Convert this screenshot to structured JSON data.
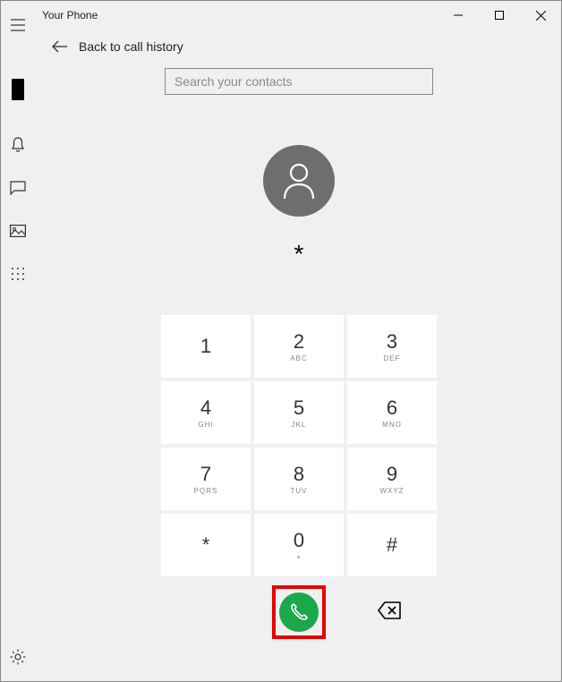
{
  "app": {
    "title": "Your Phone"
  },
  "back": {
    "label": "Back to call history"
  },
  "search": {
    "placeholder": "Search your contacts",
    "value": ""
  },
  "dialed": "*",
  "keypad": [
    {
      "digit": "1",
      "letters": ""
    },
    {
      "digit": "2",
      "letters": "ABC"
    },
    {
      "digit": "3",
      "letters": "DEF"
    },
    {
      "digit": "4",
      "letters": "GHI"
    },
    {
      "digit": "5",
      "letters": "JKL"
    },
    {
      "digit": "6",
      "letters": "MNO"
    },
    {
      "digit": "7",
      "letters": "PQRS"
    },
    {
      "digit": "8",
      "letters": "TUV"
    },
    {
      "digit": "9",
      "letters": "WXYZ"
    },
    {
      "digit": "*",
      "letters": ""
    },
    {
      "digit": "0",
      "letters": "+"
    },
    {
      "digit": "#",
      "letters": ""
    }
  ],
  "sidebar": {
    "items": [
      {
        "name": "phone"
      },
      {
        "name": "notifications"
      },
      {
        "name": "messages"
      },
      {
        "name": "photos"
      },
      {
        "name": "calls"
      }
    ]
  }
}
